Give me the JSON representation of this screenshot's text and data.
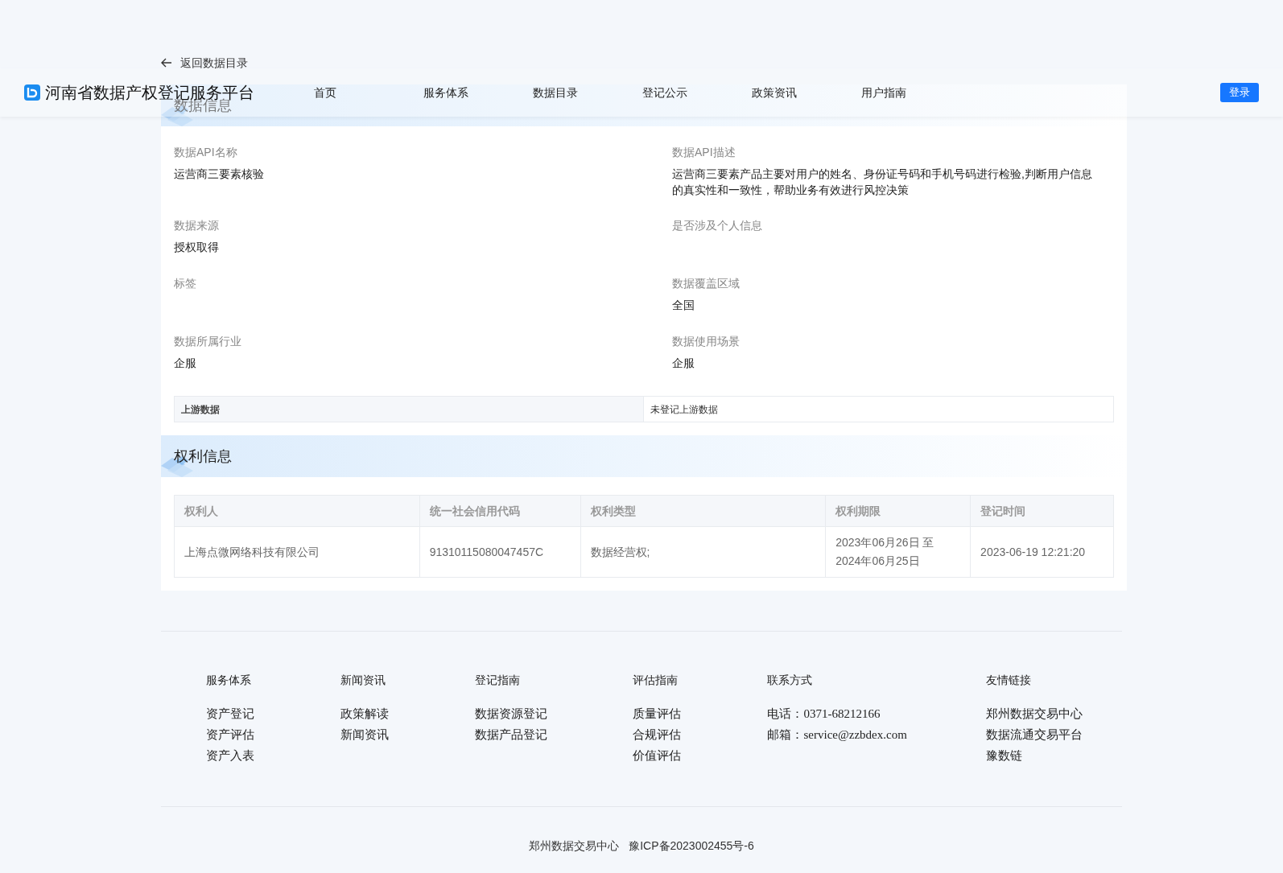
{
  "header": {
    "logo_text": "河南省数据产权登记服务平台",
    "nav": [
      "首页",
      "服务体系",
      "数据目录",
      "登记公示",
      "政策资讯",
      "用户指南"
    ],
    "login": "登录"
  },
  "back_link": "返回数据目录",
  "data_info": {
    "title": "数据信息",
    "fields": [
      {
        "label": "数据API名称",
        "value": "运营商三要素核验"
      },
      {
        "label": "数据API描述",
        "value": "运营商三要素产品主要对用户的姓名、身份证号码和手机号码进行检验,判断用户信息的真实性和一致性，帮助业务有效进行风控决策"
      },
      {
        "label": "数据来源",
        "value": "授权取得"
      },
      {
        "label": "是否涉及个人信息"
      },
      {
        "label": "标签"
      },
      {
        "label": "数据覆盖区域",
        "value": "全国"
      },
      {
        "label": "数据所属行业",
        "value": "企服"
      },
      {
        "label": "数据使用场景",
        "value": "企服"
      }
    ],
    "upstream": {
      "label": "上游数据",
      "value": "未登记上游数据"
    }
  },
  "rights_info": {
    "title": "权利信息",
    "columns": [
      "权利人",
      "统一社会信用代码",
      "权利类型",
      "权利期限",
      "登记时间"
    ],
    "rows": [
      [
        "上海点微网络科技有限公司",
        "91310115080047457C",
        "数据经营权;",
        "2023年06月26日 至 2024年06月25日",
        "2023-06-19 12:21:20"
      ]
    ]
  },
  "footer": {
    "columns": [
      {
        "title": "服务体系",
        "links": [
          "资产登记",
          "资产评估",
          "资产入表"
        ]
      },
      {
        "title": "新闻资讯",
        "links": [
          "政策解读",
          "新闻资讯"
        ]
      },
      {
        "title": "登记指南",
        "links": [
          "数据资源登记",
          "数据产品登记"
        ]
      },
      {
        "title": "评估指南",
        "links": [
          "质量评估",
          "合规评估",
          "价值评估"
        ]
      },
      {
        "title": "联系方式",
        "links": [
          "电话：0371-68212166",
          "邮箱：service@zzbdex.com"
        ]
      },
      {
        "title": "友情链接",
        "links": [
          "郑州数据交易中心",
          "数据流通交易平台",
          "豫数链"
        ]
      }
    ],
    "copyright": [
      "郑州数据交易中心",
      "豫ICP备2023002455号-6"
    ]
  }
}
